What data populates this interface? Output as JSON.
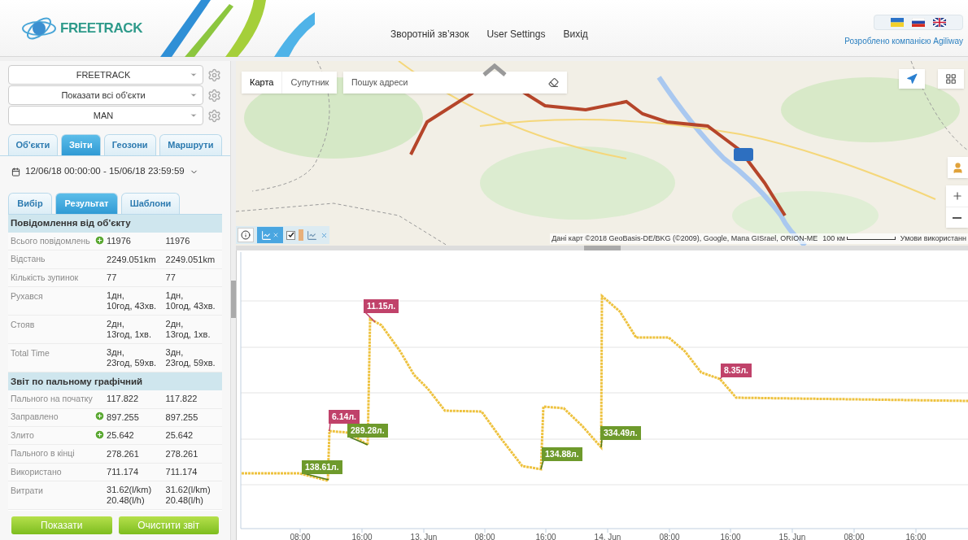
{
  "header": {
    "logo_text": "FREETRACK",
    "nav": [
      "Зворотній зв’язок",
      "User Settings",
      "Вихід"
    ],
    "credit": "Розроблено компанією Agiliway"
  },
  "sidebar": {
    "selects": [
      "FREETRACK",
      "Показати всі об'єкти",
      "MAN"
    ],
    "tabs": [
      {
        "label": "Об'єкти",
        "selected": false
      },
      {
        "label": "Звіти",
        "selected": true
      },
      {
        "label": "Геозони",
        "selected": false
      },
      {
        "label": "Маршрути",
        "selected": false
      }
    ],
    "date_range": "12/06/18 00:00:00 - 15/06/18 23:59:59",
    "subtabs": [
      {
        "label": "Вибір",
        "selected": false
      },
      {
        "label": "Результат",
        "selected": true
      },
      {
        "label": "Шаблони",
        "selected": false
      }
    ],
    "sections": [
      {
        "title": "Повідомлення від об'єкту",
        "rows": [
          {
            "label": "Всього повідомлень",
            "plus": true,
            "values": [
              "11976",
              "11976"
            ]
          },
          {
            "label": "Відстань",
            "plus": false,
            "values": [
              "2249.051km",
              "2249.051km"
            ]
          },
          {
            "label": "Кількість зупинок",
            "plus": false,
            "values": [
              "77",
              "77"
            ]
          },
          {
            "label": "Рухався",
            "plus": false,
            "values": [
              "1дн,\n10год, 43хв.",
              "1дн,\n10год, 43хв."
            ]
          },
          {
            "label": "Стояв",
            "plus": false,
            "values": [
              "2дн,\n13год, 1хв.",
              "2дн,\n13год, 1хв."
            ]
          },
          {
            "label": "Total Time",
            "plus": false,
            "values": [
              "3дн,\n23год, 59хв.",
              "3дн,\n23год, 59хв."
            ]
          }
        ]
      },
      {
        "title": "Звіт по пальному графічний",
        "rows": [
          {
            "label": "Пального на початку",
            "plus": false,
            "values": [
              "117.822",
              "117.822"
            ]
          },
          {
            "label": "Заправлено",
            "plus": true,
            "values": [
              "897.255",
              "897.255"
            ]
          },
          {
            "label": "Злито",
            "plus": true,
            "values": [
              "25.642",
              "25.642"
            ]
          },
          {
            "label": "Пального в кінці",
            "plus": false,
            "values": [
              "278.261",
              "278.261"
            ]
          },
          {
            "label": "Використано",
            "plus": false,
            "values": [
              "711.174",
              "711.174"
            ]
          },
          {
            "label": "Витрати",
            "plus": false,
            "values": [
              "31.62(l/km)\n20.48(l/h)",
              "31.62(l/km)\n20.48(l/h)"
            ]
          }
        ]
      }
    ],
    "buttons": [
      "Показати",
      "Очистити звіт"
    ]
  },
  "map": {
    "map_types": [
      {
        "label": "Карта",
        "selected": true
      },
      {
        "label": "Супутник",
        "selected": false
      }
    ],
    "search": {
      "placeholder": "Пошук адреси"
    },
    "layer_toggle": {
      "checked": true
    },
    "attribution": "Дані карт ©2018 GeoBasis-DE/BKG (©2009), Google, Мапа GISrael, ORION-ME",
    "scale": "100 км",
    "terms": "Умови використанн"
  },
  "chart": {
    "annotations": [
      {
        "kind": "refuel",
        "text": "138.61л."
      },
      {
        "kind": "drain",
        "text": "6.14л."
      },
      {
        "kind": "refuel",
        "text": "289.28л."
      },
      {
        "kind": "drain",
        "text": "11.15л."
      },
      {
        "kind": "refuel",
        "text": "134.88л."
      },
      {
        "kind": "refuel",
        "text": "334.49л."
      },
      {
        "kind": "drain",
        "text": "8.35л."
      }
    ],
    "x_labels": [
      "08:00",
      "16:00",
      "13. Jun",
      "08:00",
      "16:00",
      "14. Jun",
      "08:00",
      "16:00",
      "15. Jun",
      "08:00",
      "16:00"
    ]
  }
}
